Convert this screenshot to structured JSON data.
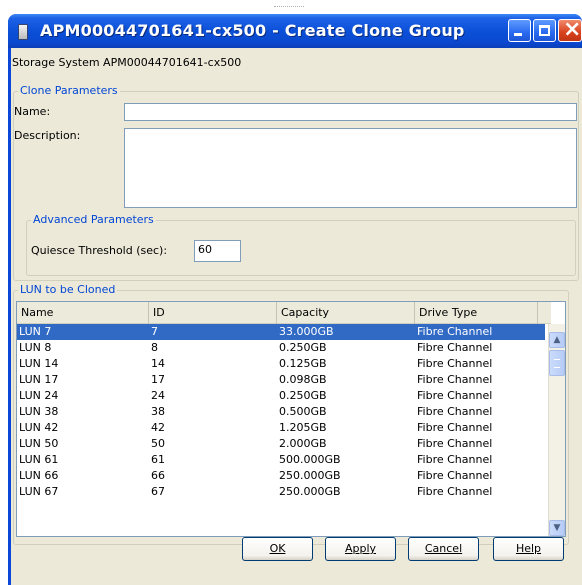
{
  "window": {
    "title": "APM00044701641-cx500 - Create Clone Group",
    "minimize_icon": "minimize-icon",
    "maximize_icon": "maximize-icon",
    "close_icon": "close-icon"
  },
  "storage_system": "Storage System APM00044701641-cx500",
  "clone_parameters": {
    "legend": "Clone Parameters",
    "name_label": "Name:",
    "name_value": "",
    "description_label": "Description:",
    "description_value": ""
  },
  "advanced_parameters": {
    "legend": "Advanced Parameters",
    "quiesce_label": "Quiesce Threshold (sec):",
    "quiesce_value": "60"
  },
  "lun_section": {
    "legend": "LUN to be Cloned",
    "columns": [
      "Name",
      "ID",
      "Capacity",
      "Drive Type"
    ],
    "rows": [
      {
        "name": "LUN 7",
        "id": "7",
        "capacity": "33.000GB",
        "drive": "Fibre Channel",
        "selected": true
      },
      {
        "name": "LUN 8",
        "id": "8",
        "capacity": "0.250GB",
        "drive": "Fibre Channel"
      },
      {
        "name": "LUN 14",
        "id": "14",
        "capacity": "0.125GB",
        "drive": "Fibre Channel"
      },
      {
        "name": "LUN 17",
        "id": "17",
        "capacity": "0.098GB",
        "drive": "Fibre Channel"
      },
      {
        "name": "LUN 24",
        "id": "24",
        "capacity": "0.250GB",
        "drive": "Fibre Channel"
      },
      {
        "name": "LUN 38",
        "id": "38",
        "capacity": "0.500GB",
        "drive": "Fibre Channel"
      },
      {
        "name": "LUN 42",
        "id": "42",
        "capacity": "1.205GB",
        "drive": "Fibre Channel"
      },
      {
        "name": "LUN 50",
        "id": "50",
        "capacity": "2.000GB",
        "drive": "Fibre Channel"
      },
      {
        "name": "LUN 61",
        "id": "61",
        "capacity": "500.000GB",
        "drive": "Fibre Channel"
      },
      {
        "name": "LUN 66",
        "id": "66",
        "capacity": "250.000GB",
        "drive": "Fibre Channel"
      },
      {
        "name": "LUN 67",
        "id": "67",
        "capacity": "250.000GB",
        "drive": "Fibre Channel"
      }
    ]
  },
  "buttons": {
    "ok": "OK",
    "apply": "Apply",
    "cancel": "Cancel",
    "help": "Help"
  },
  "colors": {
    "title_bar": "#0a46d8",
    "selection": "#316ac5",
    "legend_text": "#0046d5",
    "dialog_face": "#ece9d8"
  }
}
